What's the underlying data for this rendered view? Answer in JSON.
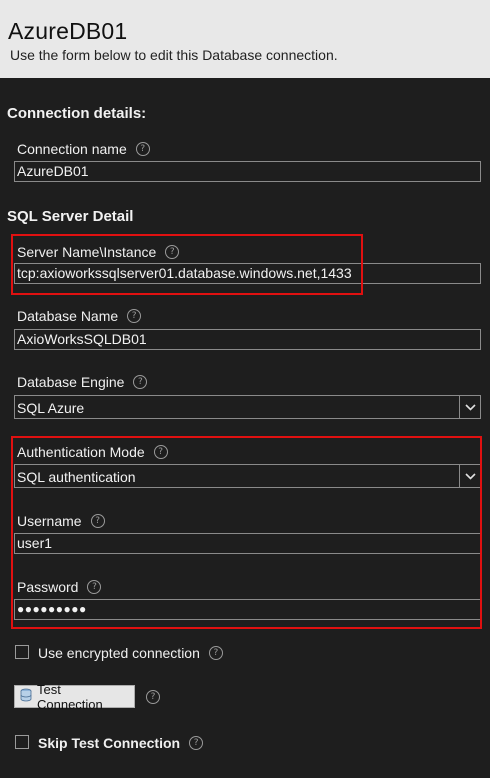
{
  "header": {
    "title": "AzureDB01",
    "subtitle": "Use the form below to edit this Database connection."
  },
  "connection_details": {
    "heading": "Connection details:",
    "connection_name": {
      "label": "Connection name",
      "value": "AzureDB01"
    }
  },
  "sql_server_detail": {
    "heading": "SQL Server Detail",
    "server_name": {
      "label": "Server Name\\Instance",
      "value": "tcp:axioworkssqlserver01.database.windows.net,1433"
    },
    "database_name": {
      "label": "Database Name",
      "value": "AxioWorksSQLDB01"
    },
    "database_engine": {
      "label": "Database Engine",
      "selected": "SQL Azure"
    },
    "authentication_mode": {
      "label": "Authentication Mode",
      "selected": "SQL authentication"
    },
    "username": {
      "label": "Username",
      "value": "user1"
    },
    "password": {
      "label": "Password",
      "value": "●●●●●●●●●"
    }
  },
  "options": {
    "use_encrypted": {
      "label": "Use encrypted connection",
      "checked": false
    },
    "test_button": {
      "label": "Test Connection"
    },
    "skip_test": {
      "label": "Skip Test Connection",
      "checked": false
    }
  },
  "icons": {
    "help": "?"
  },
  "colors": {
    "highlight": "#e01010",
    "background": "#1e1e1e",
    "header": "#e8e8e8"
  }
}
